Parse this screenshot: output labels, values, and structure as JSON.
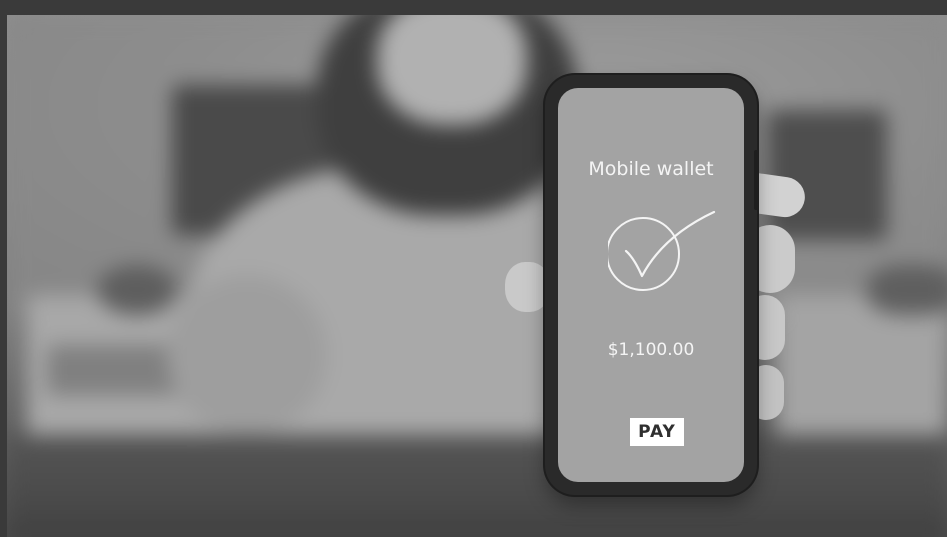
{
  "wallet": {
    "title": "Mobile wallet",
    "amount": "$1,100.00",
    "pay_label": "PAY",
    "status_icon": "check-circle-icon"
  },
  "colors": {
    "screen": "#a3a3a3",
    "phone_body": "#2a2a2a",
    "text": "#f4f4f4",
    "button_bg": "#ffffff",
    "button_text": "#2f2f2f"
  }
}
